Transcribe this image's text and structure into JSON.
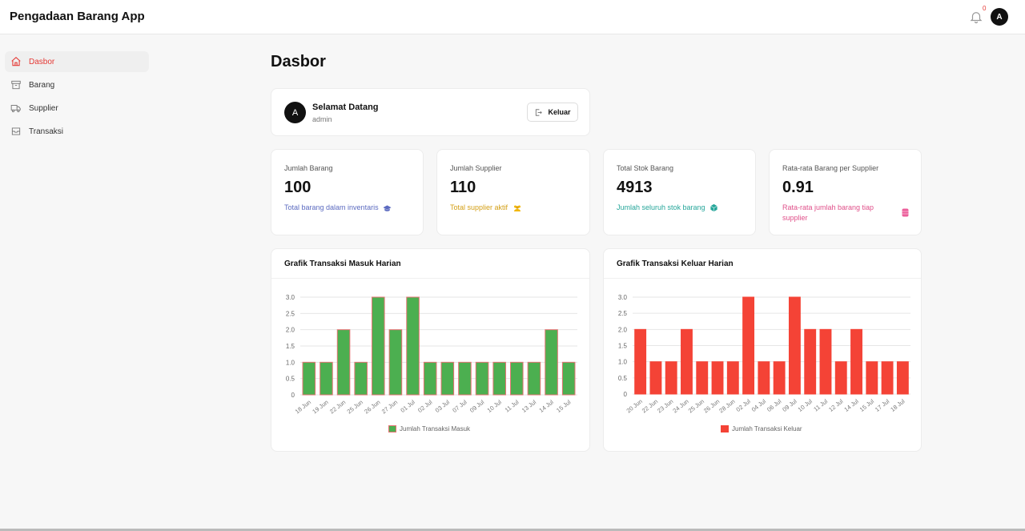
{
  "app": {
    "title": "Pengadaan Barang App",
    "notification_count": "0",
    "user_initial": "A"
  },
  "sidebar": {
    "items": [
      {
        "label": "Dasbor",
        "icon": "home-icon",
        "active": true
      },
      {
        "label": "Barang",
        "icon": "box-icon",
        "active": false
      },
      {
        "label": "Supplier",
        "icon": "truck-icon",
        "active": false
      },
      {
        "label": "Transaksi",
        "icon": "tray-icon",
        "active": false
      }
    ]
  },
  "page": {
    "title": "Dasbor"
  },
  "welcome": {
    "initial": "A",
    "title": "Selamat Datang",
    "subtitle": "admin",
    "logout_label": "Keluar"
  },
  "stats": [
    {
      "label": "Jumlah Barang",
      "value": "100",
      "desc": "Total barang dalam inventaris",
      "color": "#5c6bc0",
      "icon": "graduation-cap-icon"
    },
    {
      "label": "Jumlah Supplier",
      "value": "110",
      "desc": "Total supplier aktif",
      "color": "#d4a017",
      "icon": "users-icon"
    },
    {
      "label": "Total Stok Barang",
      "value": "4913",
      "desc": "Jumlah seluruh stok barang",
      "color": "#26a69a",
      "icon": "cube-icon"
    },
    {
      "label": "Rata-rata Barang per Supplier",
      "value": "0.91",
      "desc": "Rata-rata jumlah barang tiap supplier",
      "color": "#e0508a",
      "icon": "database-icon"
    }
  ],
  "chart_data": [
    {
      "type": "bar",
      "title": "Grafik Transaksi Masuk Harian",
      "categories": [
        "18 Jun",
        "19 Jun",
        "22 Jun",
        "25 Jun",
        "26 Jun",
        "27 Jun",
        "01 Jul",
        "02 Jul",
        "03 Jul",
        "07 Jul",
        "09 Jul",
        "10 Jul",
        "11 Jul",
        "13 Jul",
        "14 Jul",
        "15 Jul"
      ],
      "series": [
        {
          "name": "Jumlah Transaksi Masuk",
          "values": [
            1,
            1,
            2,
            1,
            3,
            2,
            3,
            1,
            1,
            1,
            1,
            1,
            1,
            1,
            2,
            1
          ],
          "color": "#4caf50",
          "border": "#e57373"
        }
      ],
      "yticks": [
        "0",
        "0.5",
        "1.0",
        "1.5",
        "2.0",
        "2.5",
        "3.0"
      ],
      "ylim": [
        0,
        3
      ],
      "grid": true,
      "legend": "bottom"
    },
    {
      "type": "bar",
      "title": "Grafik Transaksi Keluar Harian",
      "categories": [
        "20 Jun",
        "22 Jun",
        "23 Jun",
        "24 Jun",
        "25 Jun",
        "26 Jun",
        "28 Jun",
        "02 Jul",
        "04 Jul",
        "06 Jul",
        "09 Jul",
        "10 Jul",
        "11 Jul",
        "12 Jul",
        "14 Jul",
        "15 Jul",
        "17 Jul",
        "18 Jul"
      ],
      "series": [
        {
          "name": "Jumlah Transaksi Keluar",
          "values": [
            2,
            1,
            1,
            2,
            1,
            1,
            1,
            3,
            1,
            1,
            3,
            2,
            2,
            1,
            2,
            1,
            1,
            1
          ],
          "color": "#f44336",
          "border": "#f44336"
        }
      ],
      "yticks": [
        "0",
        "0.5",
        "1.0",
        "1.5",
        "2.0",
        "2.5",
        "3.0"
      ],
      "ylim": [
        0,
        3
      ],
      "grid": true,
      "legend": "bottom"
    }
  ]
}
